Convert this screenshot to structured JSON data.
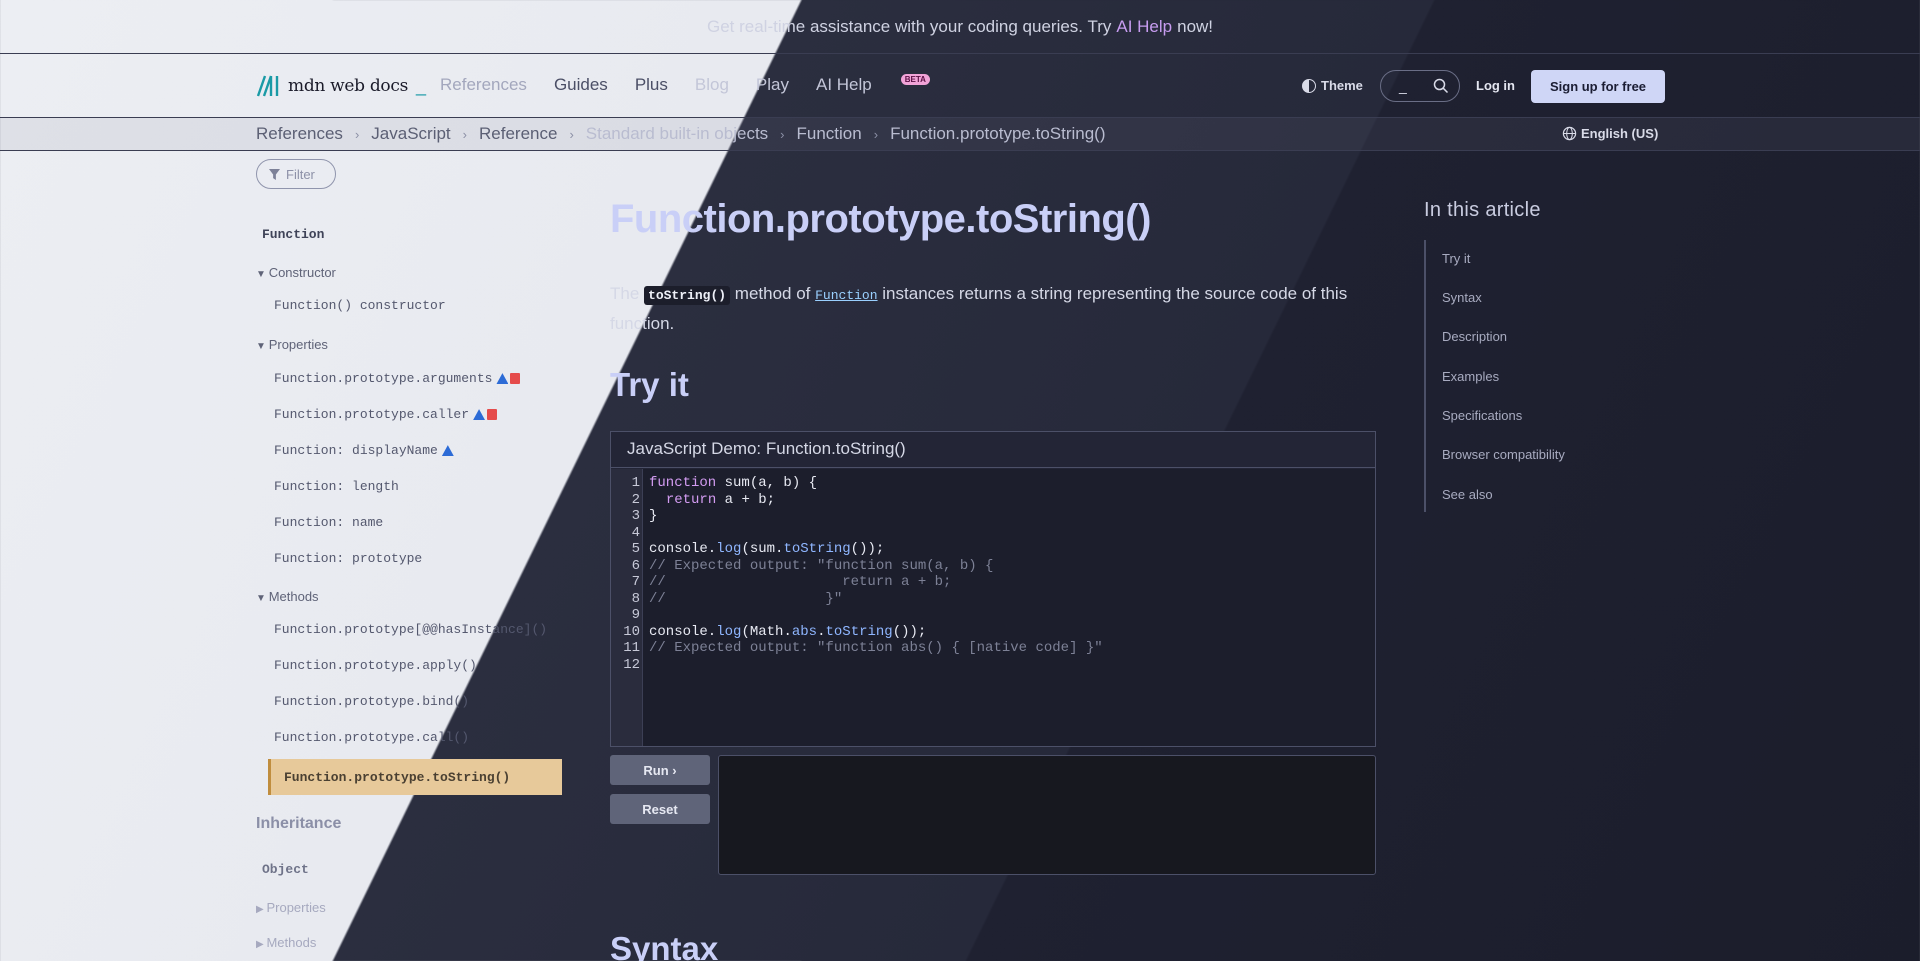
{
  "banner": {
    "prefix": "Get real-time assistance with your coding queries. Try",
    "link": "AI Help",
    "suffix": "now!"
  },
  "header": {
    "logo_text": "mdn web docs",
    "logo_cursor": "_",
    "nav": [
      "References",
      "Guides",
      "Plus",
      "Blog",
      "Play",
      "AI Help"
    ],
    "beta": "BETA",
    "theme": "Theme",
    "search_kbd": "_",
    "login": "Log in",
    "signup": "Sign up for free"
  },
  "breadcrumb": [
    "References",
    "JavaScript",
    "Reference",
    "Standard built-in objects",
    "Function",
    "Function.prototype.toString()"
  ],
  "language": "English (US)",
  "sidebar": {
    "filter_placeholder": "Filter",
    "title": "Function",
    "constructor_group": "Constructor",
    "constructor_items": [
      "Function() constructor"
    ],
    "properties_group": "Properties",
    "properties_items": [
      "Function.prototype.arguments",
      "Function.prototype.caller",
      "Function: displayName",
      "Function: length",
      "Function: name",
      "Function: prototype"
    ],
    "methods_group": "Methods",
    "methods_items": [
      "Function.prototype[@@hasInstance]()",
      "Function.prototype.apply()",
      "Function.prototype.bind()",
      "Function.prototype.call()",
      "Function.prototype.toString()"
    ],
    "inheritance": "Inheritance",
    "object_title": "Object",
    "object_properties": "Properties",
    "object_methods": "Methods"
  },
  "main": {
    "title": "Function.prototype.toString()",
    "intro_1": "The",
    "intro_code": "toString()",
    "intro_2": "method of",
    "intro_link": "Function",
    "intro_3": "instances returns a string representing the source code of this function.",
    "try_it": "Try it",
    "demo_title": "JavaScript Demo: Function.toString()",
    "code_lines": [
      "function sum(a, b) {",
      "  return a + b;",
      "}",
      "",
      "console.log(sum.toString());",
      "// Expected output: \"function sum(a, b) {",
      "//                     return a + b;",
      "//                   }\"",
      "",
      "console.log(Math.abs.toString());",
      "// Expected output: \"function abs() { [native code] }\"",
      ""
    ],
    "run": "Run ›",
    "reset": "Reset",
    "syntax": "Syntax"
  },
  "toc": {
    "title": "In this article",
    "items": [
      "Try it",
      "Syntax",
      "Description",
      "Examples",
      "Specifications",
      "Browser compatibility",
      "See also"
    ]
  }
}
